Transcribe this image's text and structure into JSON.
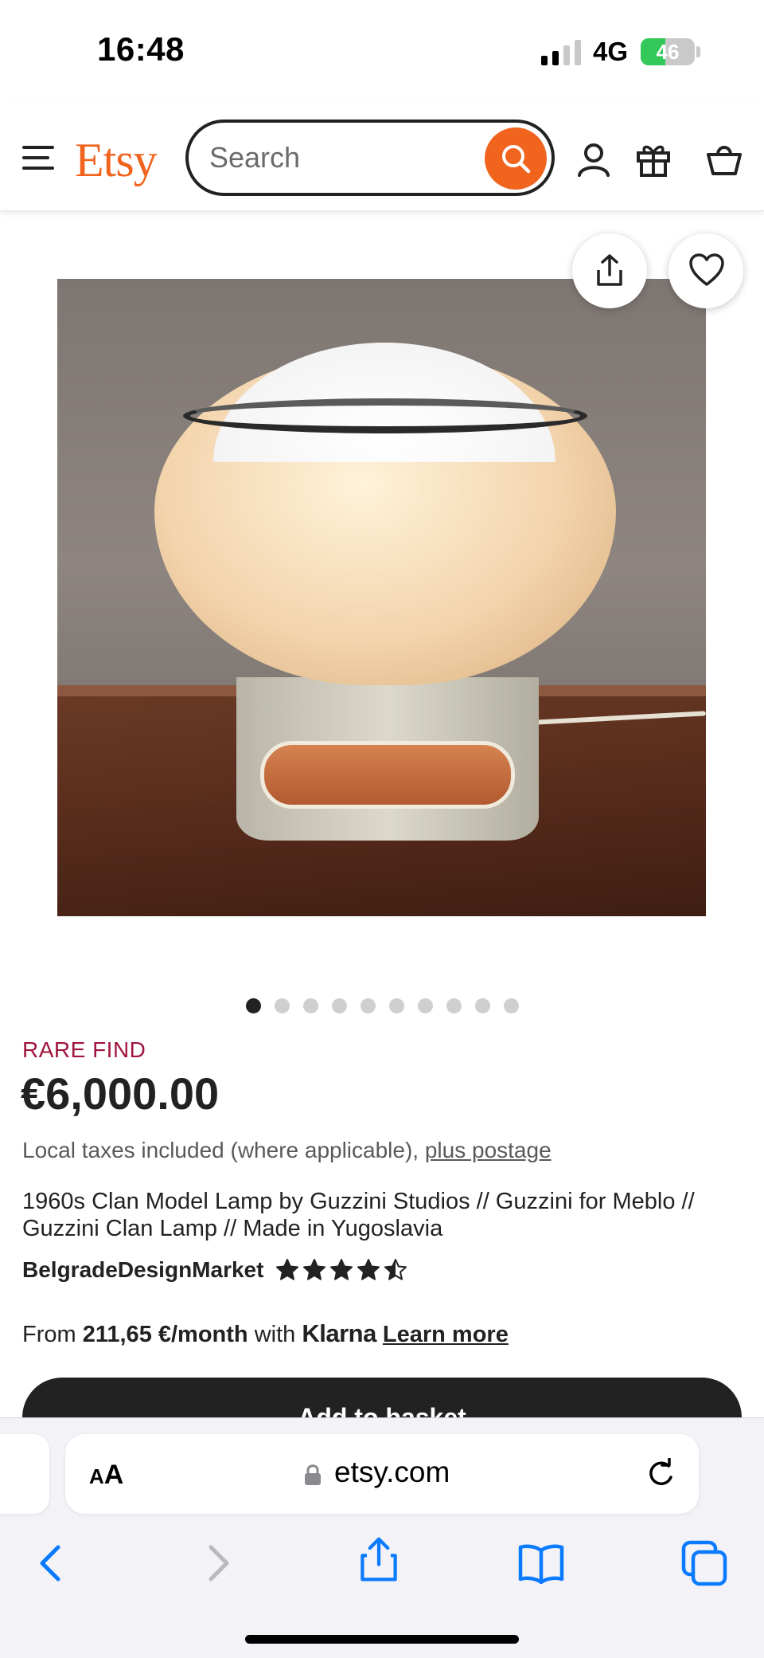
{
  "status_bar": {
    "time": "16:48",
    "network": "4G",
    "battery": "46"
  },
  "header": {
    "logo": "Etsy",
    "search_placeholder": "Search",
    "icons": [
      "menu-icon",
      "search-icon",
      "user-icon",
      "gift-icon",
      "cart-icon"
    ]
  },
  "listing": {
    "image_count": 10,
    "active_image": 0,
    "badge": "RARE FIND",
    "price": "€6,000.00",
    "tax_text": "Local taxes included (where applicable), ",
    "postage_link": "plus postage",
    "title": "1960s Clan Model Lamp by Guzzini Studios // Guzzini for Meblo // Guzzini Clan Lamp // Made in Yugoslavia",
    "shop_name": "BelgradeDesignMarket",
    "rating": 4.5,
    "klarna": {
      "prefix": "From ",
      "amount": "211,65 €/month",
      "middle": " with ",
      "brand": "Klarna",
      "link": "Learn more"
    },
    "add_to_basket": "Add to basket"
  },
  "browser": {
    "text_size_label": "AA",
    "url": "etsy.com"
  },
  "colors": {
    "brand": "#f1641e",
    "badge": "#a0153e",
    "ios_blue": "#0a7aff"
  }
}
